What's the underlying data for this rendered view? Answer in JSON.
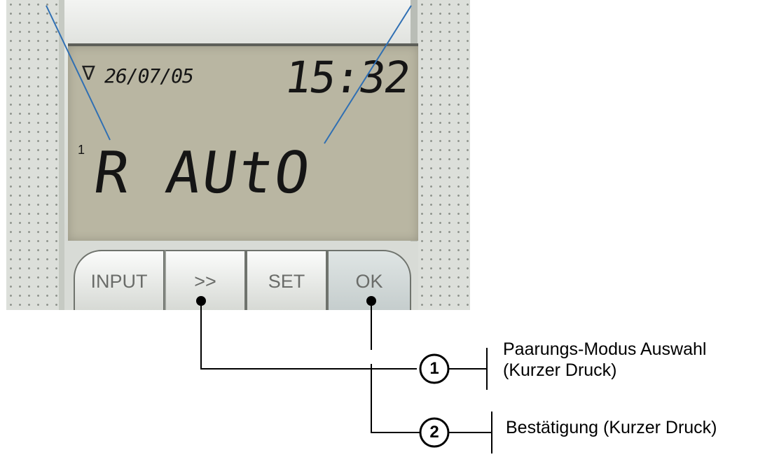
{
  "lcd": {
    "date": "26/07/05",
    "time": "15:32",
    "superscript": "1",
    "mode": "R AUtO"
  },
  "buttons": {
    "input": "INPUT",
    "next": ">>",
    "set": "SET",
    "ok": "OK"
  },
  "callouts": [
    {
      "number": "1",
      "line1": "Paarungs-Modus Auswahl",
      "line2": "(Kurzer Druck)"
    },
    {
      "number": "2",
      "line1": "Bestätigung (Kurzer Druck)"
    }
  ],
  "colors": {
    "lcd_background": "#b9b6a2",
    "pointer_lines": "#2f6fb3"
  },
  "icons": {
    "lcd_signal": "radio-signal-icon"
  }
}
